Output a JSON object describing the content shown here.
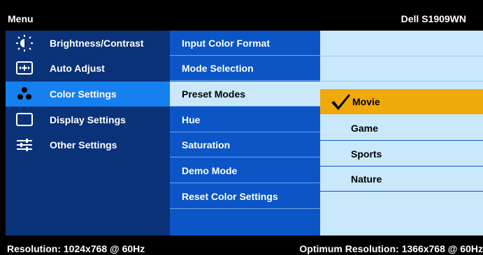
{
  "header": {
    "menu_title": "Menu",
    "model": "Dell S1909WN"
  },
  "left_menu": [
    {
      "label": "Brightness/Contrast",
      "icon": "brightness-icon",
      "active": false
    },
    {
      "label": "Auto Adjust",
      "icon": "auto-adjust-icon",
      "active": false
    },
    {
      "label": "Color Settings",
      "icon": "color-settings-icon",
      "active": true
    },
    {
      "label": "Display Settings",
      "icon": "display-settings-icon",
      "active": false
    },
    {
      "label": "Other Settings",
      "icon": "other-settings-icon",
      "active": false
    }
  ],
  "mid_menu": [
    {
      "label": "Input Color Format",
      "active": false
    },
    {
      "label": "Mode Selection",
      "active": false
    },
    {
      "label": "Preset Modes",
      "active": true
    },
    {
      "label": "Hue",
      "active": false
    },
    {
      "label": "Saturation",
      "active": false
    },
    {
      "label": "Demo Mode",
      "active": false
    },
    {
      "label": "Reset Color Settings",
      "active": false
    }
  ],
  "preset_options": [
    {
      "label": "Movie",
      "selected": true
    },
    {
      "label": "Game",
      "selected": false
    },
    {
      "label": "Sports",
      "selected": false
    },
    {
      "label": "Nature",
      "selected": false
    }
  ],
  "status": {
    "resolution": "Resolution: 1024x768 @ 60Hz",
    "optimum": "Optimum Resolution: 1366x768 @ 60Hz"
  },
  "colors": {
    "left_bg": "#0a3278",
    "left_active": "#1680f0",
    "mid_bg": "#0b55c7",
    "right_bg": "#c9e8fb",
    "selected_bg": "#f0a90a"
  }
}
